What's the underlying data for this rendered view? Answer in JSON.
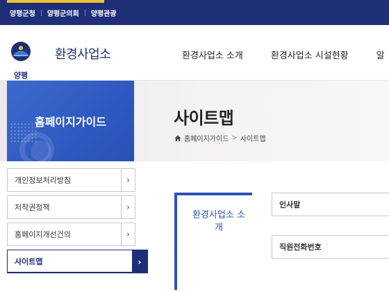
{
  "topbar": {
    "links": [
      "양평군청",
      "양평군의회",
      "양평관광"
    ],
    "accent_color": "#f2c230",
    "bg_color": "#1e2f78"
  },
  "header": {
    "logo_text": "양평",
    "site_title": "환경사업소",
    "nav": [
      "환경사업소 소개",
      "환경사업소 시설현황",
      "알"
    ]
  },
  "side": {
    "title": "홈페이지가이드",
    "menu": [
      {
        "label": "개인정보처리방침",
        "active": false
      },
      {
        "label": "저작권정책",
        "active": false
      },
      {
        "label": "홈페이지개선건의",
        "active": false
      },
      {
        "label": "사이트맵",
        "active": true
      }
    ]
  },
  "content": {
    "page_title": "사이트맵",
    "breadcrumb": [
      "홈페이지가이드",
      "사이트맵"
    ],
    "section_label": "환경사업소 소개",
    "items": [
      "인사말",
      "직원전화번호"
    ]
  }
}
